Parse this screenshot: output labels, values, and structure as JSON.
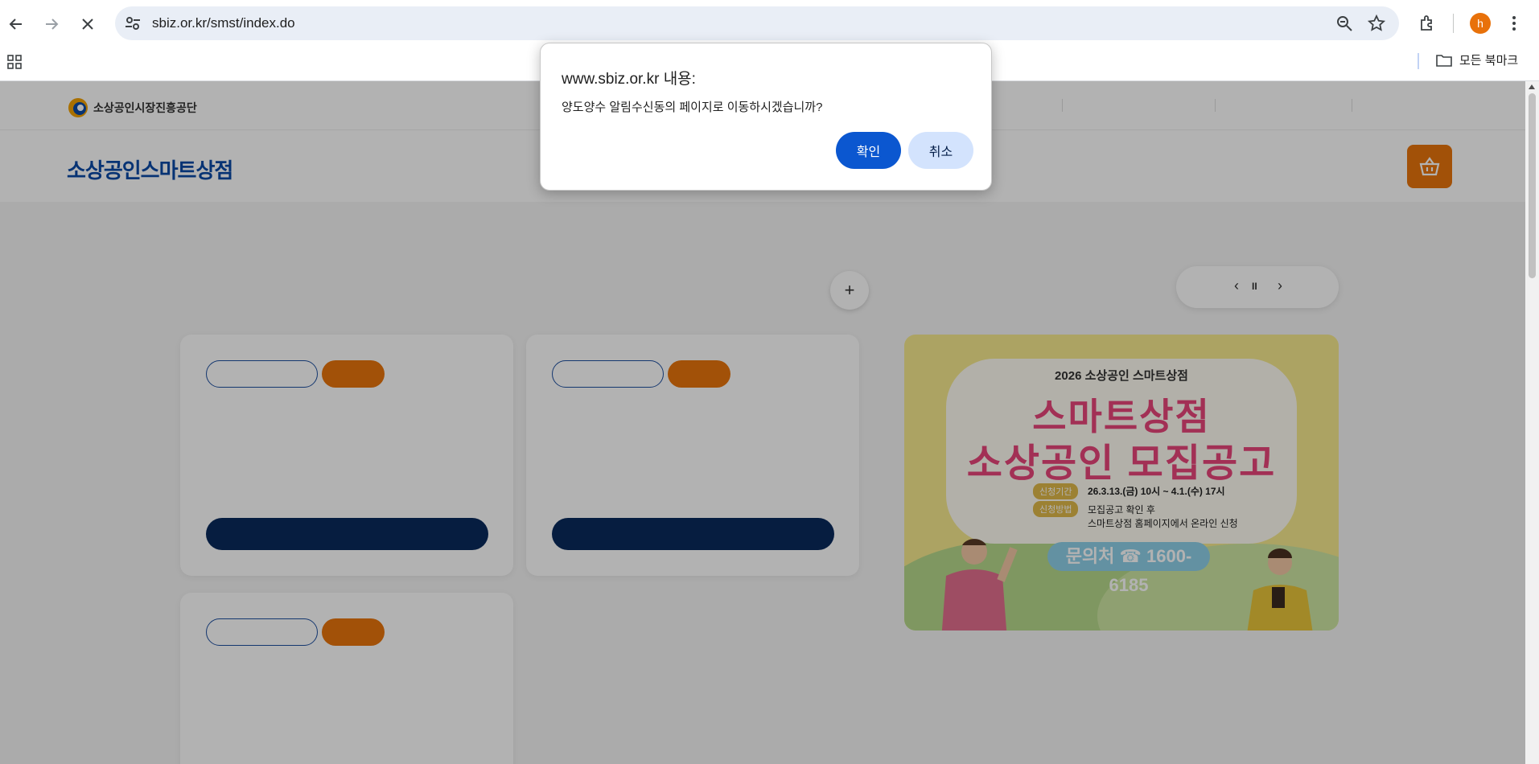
{
  "browser": {
    "url": "sbiz.or.kr/smst/index.do",
    "profile_initial": "h",
    "bookmarks_folder": "모든 북마크"
  },
  "page": {
    "org_name": "소상공인시장진흥공단",
    "brand": "소상공인스마트상점",
    "plus": "+",
    "slider_prev": "‹",
    "slider_pause": "II",
    "slider_next": "›",
    "banner": {
      "year_line": "2026 소상공인 스마트상점",
      "title_line1": "스마트상점",
      "title_line2": "소상공인 모집공고",
      "period_tag": "신청기간",
      "period": "26.3.13.(금) 10시 ~ 4.1.(수) 17시",
      "method_tag": "신청방법",
      "method_line1": "모집공고 확인 후",
      "method_line2": "스마트상점 홈페이지에서 온라인 신청",
      "contact": "문의처 ☎ 1600-6185"
    }
  },
  "dialog": {
    "title": "www.sbiz.or.kr 내용:",
    "message": "양도양수 알림수신동의 페이지로 이동하시겠습니까?",
    "ok_label": "확인",
    "cancel_label": "취소"
  },
  "colors": {
    "primary_button": "#0b57d0",
    "secondary_button": "#d3e3fd",
    "brand_orange": "#e8740c",
    "brand_navy": "#0a2a5c"
  }
}
